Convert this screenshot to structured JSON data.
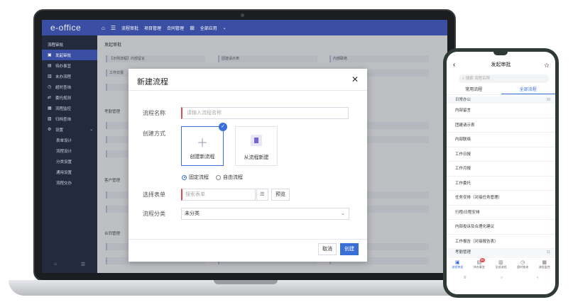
{
  "laptop": {
    "logo": "e-office",
    "topnav": [
      "流程审批",
      "项目管理",
      "合同管理",
      "全部应用"
    ],
    "sidebar": {
      "title": "流程审批",
      "items": [
        "发起审批",
        "待办事宜",
        "未办流程",
        "超时查询",
        "委托规则",
        "流程监控",
        "归档查询",
        "设置"
      ],
      "sub_items": [
        "表单设计",
        "流程设计",
        "分类设置",
        "通用设置",
        "流程交办"
      ]
    },
    "content": {
      "title": "发起审批",
      "sections": [
        "考勤管理",
        "客户管理",
        "合同管理"
      ],
      "cells": {
        "row1": [
          "【示例流程】内部留言",
          "团建请示表",
          "内部联络"
        ],
        "row2": [
          "工作日报"
        ]
      }
    },
    "dialog": {
      "title": "新建流程",
      "name_label": "流程名称",
      "name_placeholder": "请输入流程名称",
      "method_label": "创建方式",
      "card_new": "创建新流程",
      "card_from": "从流程新建",
      "radio_fixed": "固定流程",
      "radio_free": "自由流程",
      "form_label": "选择表单",
      "form_placeholder": "搜索表单",
      "preview": "预览",
      "category_label": "流程分类",
      "category_value": "未分类",
      "cancel": "取消",
      "create": "创建"
    }
  },
  "phone": {
    "title": "发起审批",
    "search_placeholder": "搜索 流程名称",
    "tabs": [
      "常用流程",
      "全部流程"
    ],
    "group_daily": "日常办公",
    "group_daily_count": "10",
    "items": [
      "内部留言",
      "团建请示表",
      "内部联络",
      "工作日报",
      "工作月报",
      "工作委托",
      "任务安排（对接任务管理）",
      "行程/日程安排",
      "内部投诉及合理化建议",
      "工作报告（对接报告表）"
    ],
    "group_attendance": "考勤管理",
    "group_attendance_count": "11",
    "nav": [
      "流程审批",
      "待办事宜",
      "全部流程",
      "超时查询",
      "流程监控"
    ],
    "badge": "99"
  }
}
